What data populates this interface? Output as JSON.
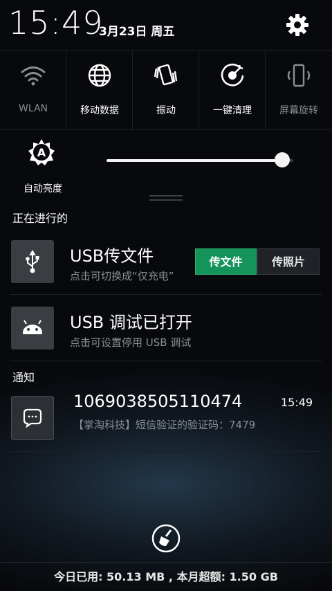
{
  "status": {
    "time": "15:49",
    "date": "3月23日 周五"
  },
  "quick_toggles": [
    {
      "label": "WLAN",
      "icon": "wifi-icon",
      "active": false
    },
    {
      "label": "移动数据",
      "icon": "globe-icon",
      "active": true
    },
    {
      "label": "振动",
      "icon": "vibrate-icon",
      "active": true
    },
    {
      "label": "一键清理",
      "icon": "clean-icon",
      "active": true
    },
    {
      "label": "屏幕旋转",
      "icon": "rotate-icon",
      "active": false
    }
  ],
  "brightness": {
    "auto_label": "自动亮度",
    "level": 0.94
  },
  "ongoing": {
    "header": "正在进行的",
    "usb_transfer": {
      "title": "USB传文件",
      "subtitle": "点击可切换成“仅充电”",
      "btn_files": "传文件",
      "btn_photos": "传照片"
    },
    "usb_debug": {
      "title": "USB 调试已打开",
      "subtitle": "点击可设置停用 USB 调试"
    }
  },
  "notifications": {
    "header": "通知",
    "items": [
      {
        "sender": "1069038505110474",
        "time": "15:49",
        "body": "【掌淘科技】短信验证的验证码：7479"
      }
    ]
  },
  "footer": {
    "data_usage": "今日已用: 50.13 MB , 本月超额: 1.50 GB"
  },
  "colors": {
    "accent_green": "#14935a",
    "bg": "#07090c",
    "muted_text": "#8a8f95"
  }
}
